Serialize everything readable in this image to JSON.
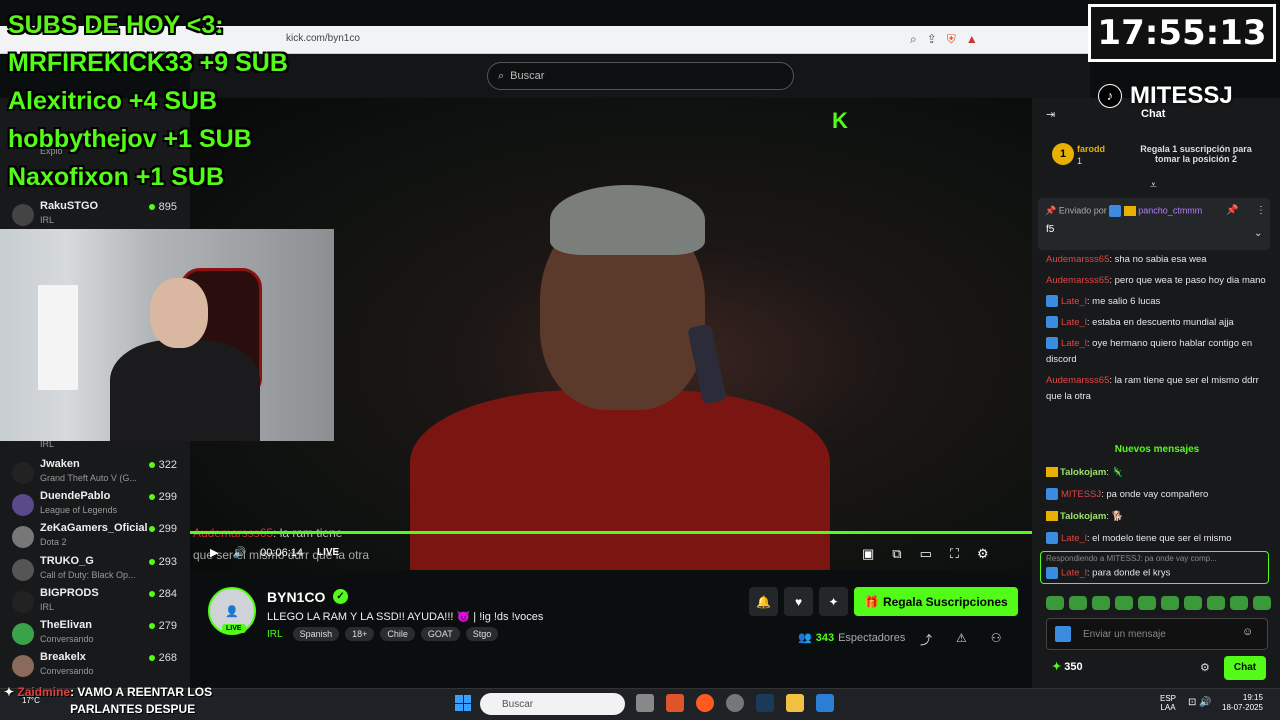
{
  "browser": {
    "url": "kick.com/byn1co"
  },
  "search": {
    "placeholder": "Buscar"
  },
  "overlay": {
    "subs_lines": [
      "SUBS DE HOY <3:",
      "MRFIREKICK33 +9 SUB",
      "Alexitrico +4 SUB",
      "hobbythejov +1 SUB",
      "Naxofixon +1 SUB"
    ],
    "clock": "17:55:13",
    "tiktok": "MITESSJ",
    "bottom_alert_user": "Zaidmine",
    "bottom_alert_text": ": VAMO A REENTAR LOS PARLANTES DESPUE"
  },
  "sidebar": {
    "partial_top": [
      {
        "label": "Explo"
      },
      {
        "name": "RakuSTGO",
        "count": "895",
        "game": "IRL"
      }
    ],
    "partial_game": "IRL",
    "items": [
      {
        "name": "Jwaken",
        "game": "Grand Theft Auto V (G...",
        "count": "322"
      },
      {
        "name": "DuendePablo",
        "game": "League of Legends",
        "count": "299"
      },
      {
        "name": "ZeKaGamers_Oficial",
        "game": "Dota 2",
        "count": "299"
      },
      {
        "name": "TRUKO_G",
        "game": "Call of Duty: Black Op...",
        "count": "293"
      },
      {
        "name": "BIGPRODS",
        "game": "IRL",
        "count": "284"
      },
      {
        "name": "TheElivan",
        "game": "Conversando",
        "count": "279"
      },
      {
        "name": "Breakelx",
        "game": "Conversando",
        "count": "268"
      }
    ]
  },
  "player": {
    "time": "00:06:14",
    "live": "LIVE",
    "overlay_user": "Audemarsss65",
    "overlay_text": ": la ram tiene",
    "overlay_text2": "que ser el mismo ddrr que la otra"
  },
  "channel": {
    "name": "BYN1CO",
    "live_badge": "LIVE",
    "title": "LLEGO LA RAM Y LA SSD!! AYUDA!!! 😈 | !ig !ds !voces",
    "category": "IRL",
    "tags": [
      "Spanish",
      "18+",
      "Chile",
      "GOAT",
      "Stgo"
    ],
    "sub_button": "Regala Suscripciones",
    "viewers_count": "343",
    "viewers_label": "Espectadores"
  },
  "chat": {
    "title": "Chat",
    "top_sub": {
      "rank": "1",
      "name": "farodd",
      "count": "1",
      "cta": "Regala 1 suscripción para tomar la posición 2"
    },
    "pinned": {
      "by_label": "Enviado por",
      "by_user": "pancho_ctmmm",
      "message": "f5"
    },
    "messages": [
      {
        "user": "Audemarsss65",
        "text": ": sha no sabia esa wea"
      },
      {
        "user": "Audemarsss65",
        "text": ": pero que wea te paso hoy dia mano"
      },
      {
        "user": "Late_l",
        "text": ": me salio 6 lucas"
      },
      {
        "user": "Late_l",
        "text": ": estaba en descuento mundial ajja"
      },
      {
        "user": "Late_l",
        "text": ": oye hermano quiero hablar contigo en discord"
      },
      {
        "user": "Audemarsss65",
        "text": ": la ram tiene que ser el mismo ddrr que la otra"
      }
    ],
    "new_messages": "Nuevos mensajes",
    "messages2": [
      {
        "user": "Talokojam",
        "text": ":",
        "style": "g"
      },
      {
        "user": "MITESSJ",
        "text": ": pa onde vay compañero",
        "style": "u"
      },
      {
        "user": "Talokojam",
        "text": ":",
        "style": "g"
      },
      {
        "user": "Late_l",
        "text": ": el modelo tiene que ser el mismo",
        "style": "u"
      }
    ],
    "reply_to": "Respondiendo a MITESSJ: pa onde vay comp...",
    "reply_user": "Late_l",
    "reply_text": ": para donde el krys",
    "input_placeholder": "Enviar un mensaje",
    "points": "350",
    "send": "Chat"
  },
  "taskbar": {
    "search": "Buscar",
    "weather": "17°C",
    "lang1": "ESP",
    "lang2": "LAA",
    "time": "19:15",
    "date": "18-07-2025"
  }
}
